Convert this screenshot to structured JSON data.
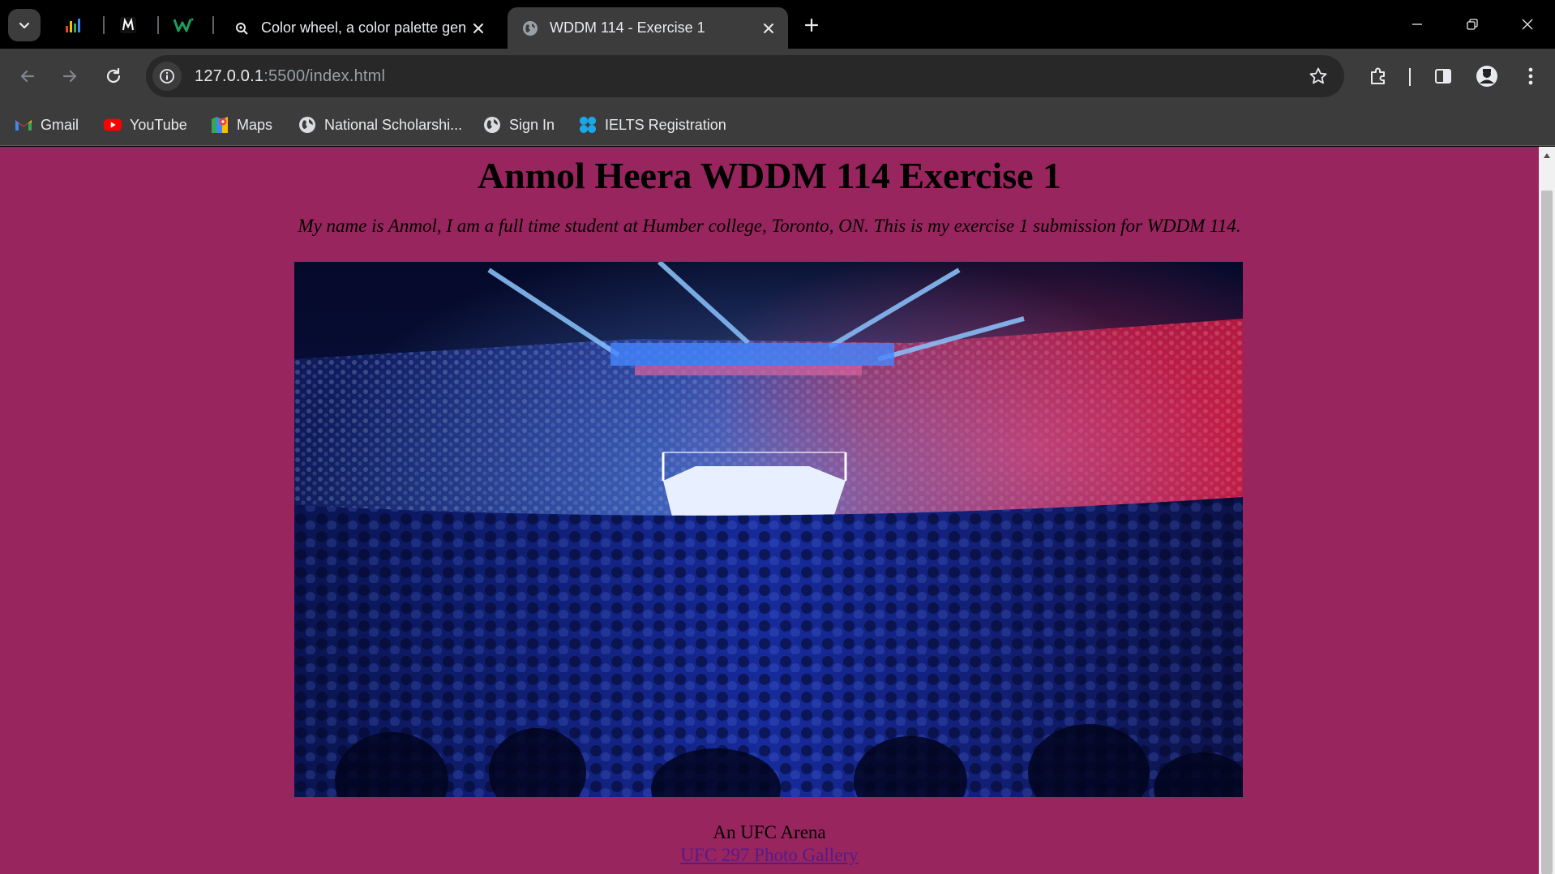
{
  "browser": {
    "tabs": [
      {
        "title": "Color wheel, a color palette generator",
        "favicon": "adobe-color-icon",
        "active": false
      },
      {
        "title": "WDDM 114 - Exercise 1",
        "favicon": "globe-icon",
        "active": true
      }
    ],
    "pinned_tabs": [
      "analytics-icon",
      "m-logo-icon",
      "w-logo-icon"
    ],
    "url_host": "127.0.0.1",
    "url_path": ":5500/index.html",
    "bookmarks": [
      {
        "label": "Gmail",
        "icon": "gmail-icon"
      },
      {
        "label": "YouTube",
        "icon": "youtube-icon"
      },
      {
        "label": "Maps",
        "icon": "maps-icon"
      },
      {
        "label": "National Scholarshi...",
        "icon": "globe-icon"
      },
      {
        "label": "Sign In",
        "icon": "globe-icon"
      },
      {
        "label": "IELTS Registration",
        "icon": "ielts-icon"
      }
    ]
  },
  "page": {
    "background": "#98255d",
    "heading": "Anmol Heera WDDM 114 Exercise 1",
    "intro": "My name is Anmol, I am a full time student at Humber college, Toronto, ON. This is my exercise 1 submission for WDDM 114.",
    "image_subject": "UFC arena crowd with octagon under red and blue lights",
    "caption": "An UFC Arena",
    "link_text": "UFC 297 Photo Gallery"
  }
}
